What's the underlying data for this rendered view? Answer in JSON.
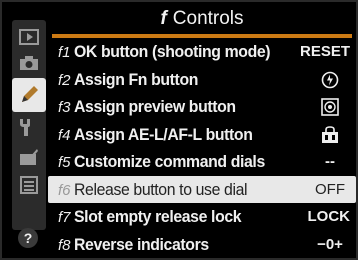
{
  "header": {
    "menu_prefix": "f",
    "title": "Controls"
  },
  "menu": {
    "items": [
      {
        "code": "f1",
        "label": "OK button (shooting mode)",
        "value": "RESET"
      },
      {
        "code": "f2",
        "label": "Assign Fn button",
        "value": "",
        "icon": "bracket-icon"
      },
      {
        "code": "f3",
        "label": "Assign preview button",
        "value": "",
        "icon": "shutter-icon"
      },
      {
        "code": "f4",
        "label": "Assign AE-L/AF-L button",
        "value": "",
        "icon": "ae-af-lock-icon"
      },
      {
        "code": "f5",
        "label": "Customize command dials",
        "value": "--"
      },
      {
        "code": "f6",
        "label": "Release button to use dial",
        "value": "OFF"
      },
      {
        "code": "f7",
        "label": "Slot empty release lock",
        "value": "LOCK"
      },
      {
        "code": "f8",
        "label": "Reverse indicators",
        "value": "−0+"
      }
    ],
    "selected_index": 5
  },
  "sidebar": {
    "icons": [
      "playback-icon",
      "camera-icon",
      "pencil-icon",
      "wrench-icon",
      "retouch-icon",
      "my-menu-icon"
    ],
    "active": "pencil-icon",
    "help_label": "?"
  },
  "colors": {
    "accent": "#cc7a14",
    "highlight": "#e8e8e8",
    "background": "#000000"
  }
}
